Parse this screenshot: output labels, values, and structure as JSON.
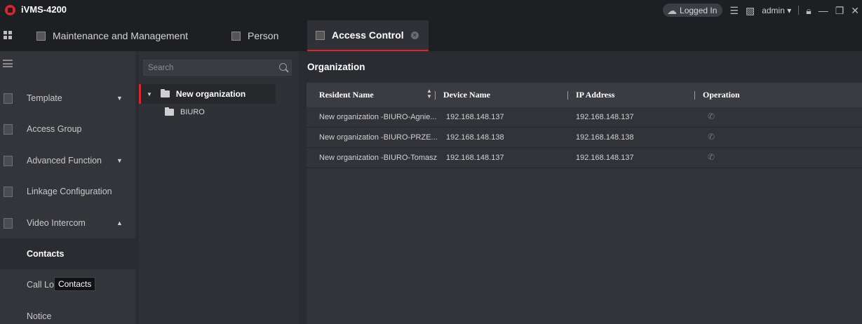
{
  "app": {
    "title": "iVMS-4200",
    "accent_color": "#d8262f"
  },
  "titlebar": {
    "logged_in_label": "Logged In",
    "user": "admin",
    "icons": [
      "cloud-icon",
      "list-icon",
      "image-icon",
      "lock-icon",
      "minimize-icon",
      "restore-icon",
      "close-icon"
    ]
  },
  "tabs": [
    {
      "label": "Maintenance and Management",
      "active": false
    },
    {
      "label": "Person",
      "active": false
    },
    {
      "label": "Access Control",
      "active": true
    }
  ],
  "sidebar": {
    "items": [
      {
        "label": "Template",
        "arrow": "▼"
      },
      {
        "label": "Access Group"
      },
      {
        "label": "Advanced Function",
        "arrow": "▼"
      },
      {
        "label": "Linkage Configuration"
      },
      {
        "label": "Video Intercom",
        "arrow": "▲"
      },
      {
        "label": "Contacts",
        "active": true
      },
      {
        "label": "Call Lo"
      },
      {
        "label": "Notice"
      }
    ],
    "tooltip": "Contacts"
  },
  "tree": {
    "search_placeholder": "Search",
    "root": "New organization",
    "children": [
      "BIURO"
    ]
  },
  "main": {
    "title": "Organization",
    "columns": [
      "Resident Name",
      "Device Name",
      "IP Address",
      "Operation"
    ],
    "rows": [
      {
        "resident": "New organization -BIURO-Agnie...",
        "device": "192.168.148.137",
        "ip": "192.168.148.137"
      },
      {
        "resident": "New organization -BIURO-PRZE...",
        "device": "192.168.148.138",
        "ip": "192.168.148.138"
      },
      {
        "resident": "New organization -BIURO-Tomasz",
        "device": "192.168.148.137",
        "ip": "192.168.148.137"
      }
    ]
  }
}
